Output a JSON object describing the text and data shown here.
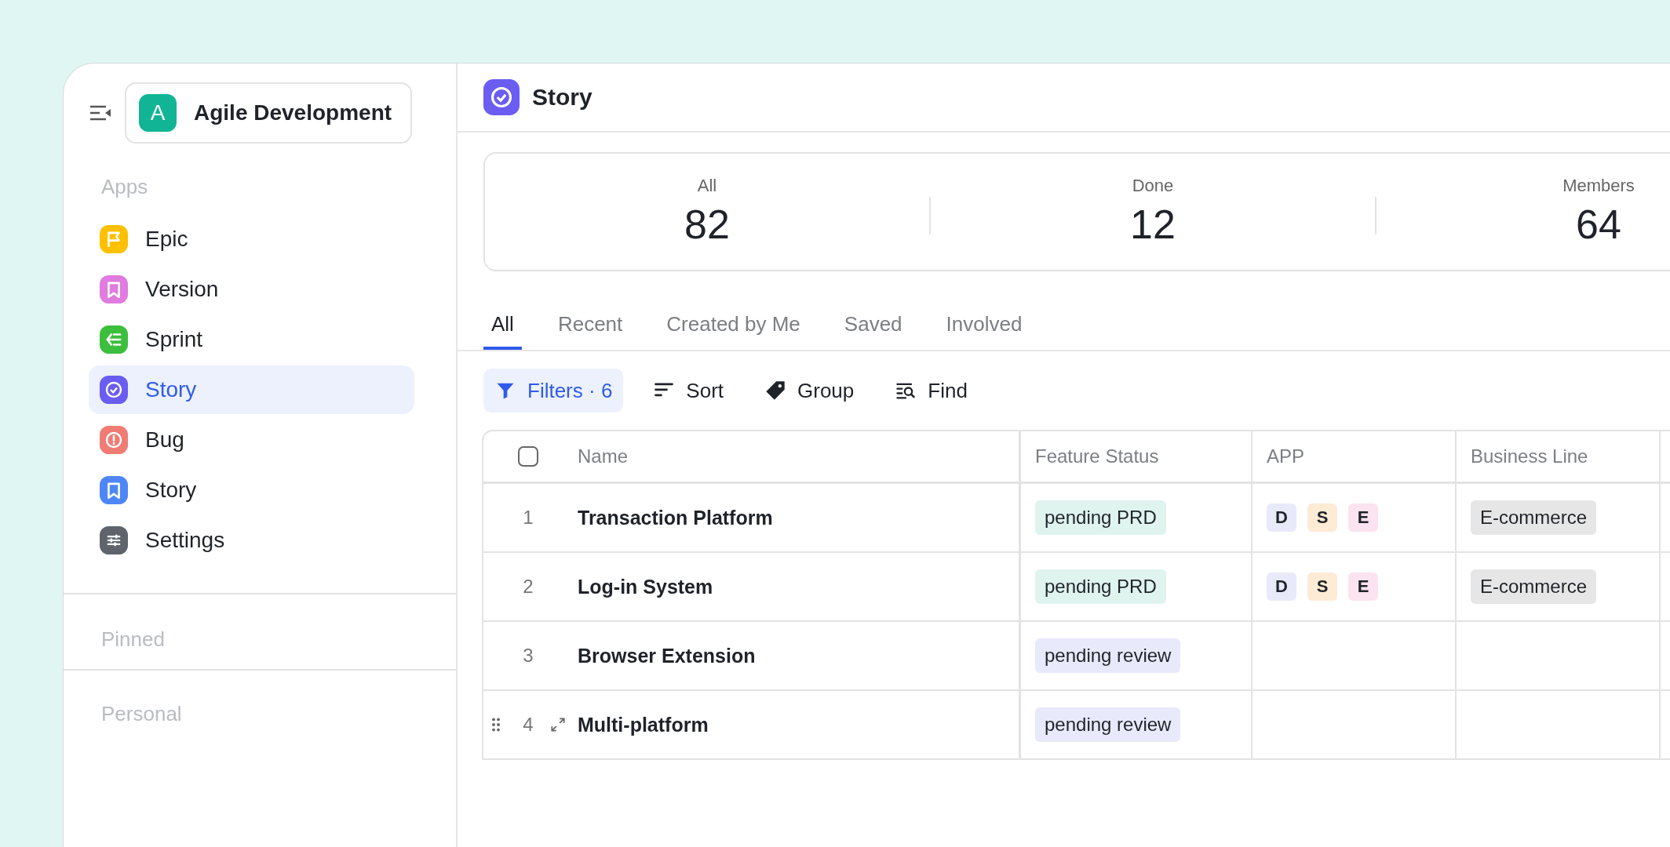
{
  "workspace": {
    "initial": "A",
    "name": "Agile Development"
  },
  "sidebar": {
    "apps_heading": "Apps",
    "items": [
      {
        "label": "Epic",
        "kind": "flag",
        "color": "#ffc000",
        "selected": false
      },
      {
        "label": "Version",
        "kind": "bookmark",
        "color": "#e07bdf",
        "selected": false
      },
      {
        "label": "Sprint",
        "kind": "list",
        "color": "#3cbf3c",
        "selected": false
      },
      {
        "label": "Story",
        "kind": "check",
        "color": "#6b5cf2",
        "selected": true
      },
      {
        "label": "Bug",
        "kind": "alert",
        "color": "#f07c74",
        "selected": false
      },
      {
        "label": "Story",
        "kind": "bookmark",
        "color": "#4f86f7",
        "selected": false
      },
      {
        "label": "Settings",
        "kind": "sliders",
        "color": "#5f646c",
        "selected": false
      }
    ],
    "pinned_heading": "Pinned",
    "personal_heading": "Personal"
  },
  "header": {
    "title": "Story"
  },
  "stats": [
    {
      "label": "All",
      "value": "82"
    },
    {
      "label": "Done",
      "value": "12"
    },
    {
      "label": "Members",
      "value": "64"
    }
  ],
  "tabs": [
    {
      "label": "All",
      "selected": true
    },
    {
      "label": "Recent",
      "selected": false
    },
    {
      "label": "Created by Me",
      "selected": false
    },
    {
      "label": "Saved",
      "selected": false
    },
    {
      "label": "Involved",
      "selected": false
    }
  ],
  "toolbar": [
    {
      "label": "Filters · 6",
      "kind": "filter",
      "selected": true
    },
    {
      "label": "Sort",
      "kind": "sort",
      "selected": false
    },
    {
      "label": "Group",
      "kind": "tag",
      "selected": false
    },
    {
      "label": "Find",
      "kind": "find",
      "selected": false
    }
  ],
  "table": {
    "select_all_checked": false,
    "columns": [
      "Name",
      "Feature Status",
      "APP",
      "Business Line"
    ],
    "rows": [
      {
        "number": "1",
        "name": "Transaction Platform",
        "hovered": false,
        "status": {
          "label": "pending PRD",
          "color": "#dff3ef"
        },
        "apps": [
          {
            "label": "D",
            "color": "#e8eafa"
          },
          {
            "label": "S",
            "color": "#fdebd6"
          },
          {
            "label": "E",
            "color": "#fbe3ef"
          }
        ],
        "business_line": "E-commerce"
      },
      {
        "number": "2",
        "name": "Log-in System",
        "hovered": false,
        "status": {
          "label": "pending PRD",
          "color": "#dff3ef"
        },
        "apps": [
          {
            "label": "D",
            "color": "#e8eafa"
          },
          {
            "label": "S",
            "color": "#fdebd6"
          },
          {
            "label": "E",
            "color": "#fbe3ef"
          }
        ],
        "business_line": "E-commerce"
      },
      {
        "number": "3",
        "name": "Browser Extension",
        "hovered": false,
        "status": {
          "label": "pending review",
          "color": "#e8e9fb"
        },
        "apps": [],
        "business_line": ""
      },
      {
        "number": "4",
        "name": "Multi-platform",
        "hovered": true,
        "status": {
          "label": "pending review",
          "color": "#e8e9fb"
        },
        "apps": [],
        "business_line": ""
      }
    ]
  }
}
